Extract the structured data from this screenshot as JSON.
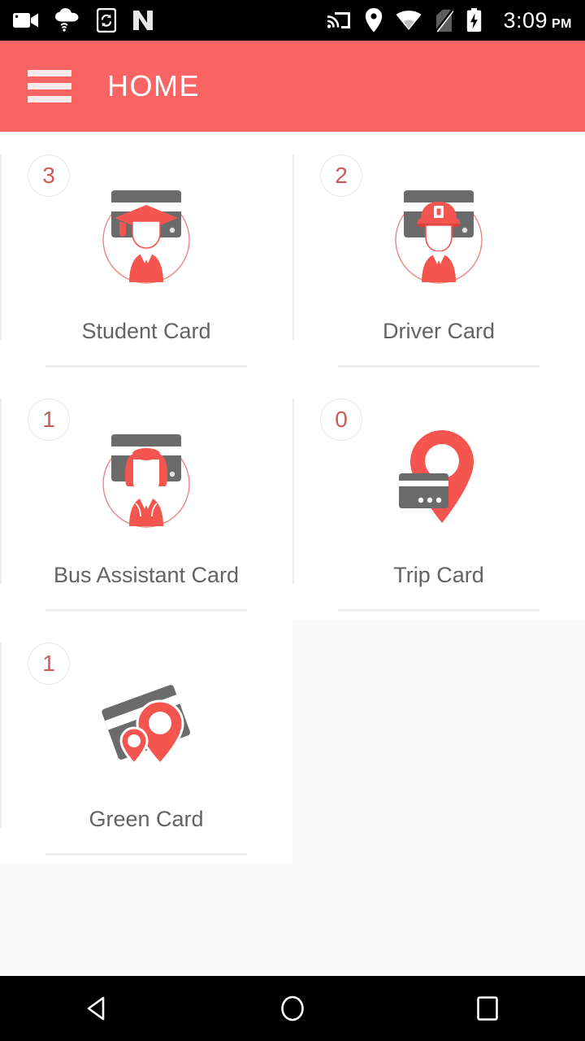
{
  "status_bar": {
    "icons_left": [
      "video-camera-icon",
      "cloud-wifi-icon",
      "phone-sync-icon",
      "nougat-n-icon"
    ],
    "icons_right": [
      "cast-screen-icon",
      "location-pin-icon",
      "wifi-icon",
      "sim-off-icon",
      "battery-charging-icon"
    ],
    "time": "3:09",
    "meridiem": "PM"
  },
  "appbar": {
    "menu_icon": "hamburger-menu-icon",
    "title": "HOME",
    "background_color": "#FB6464"
  },
  "theme": {
    "accent": "#FB6464",
    "icon_red": "#F4564F",
    "icon_gray": "#6B6B6B",
    "label_gray": "#636363",
    "badge_text": "#CC5A5A",
    "page_background": "#FAFAFA",
    "card_background": "#FFFFFF",
    "divider": "#EDEDED"
  },
  "cards": [
    {
      "id": "student-card",
      "label": "Student Card",
      "count": "3",
      "icon": "graduate-person-card-icon"
    },
    {
      "id": "driver-card",
      "label": "Driver Card",
      "count": "2",
      "icon": "driver-person-card-icon"
    },
    {
      "id": "bus-assistant-card",
      "label": "Bus Assistant Card",
      "count": "1",
      "icon": "assistant-person-card-icon"
    },
    {
      "id": "trip-card",
      "label": "Trip Card",
      "count": "0",
      "icon": "pin-credit-card-icon"
    },
    {
      "id": "green-card",
      "label": "Green Card",
      "count": "1",
      "icon": "tilted-card-two-pins-icon"
    }
  ],
  "navbar": {
    "back": "back-triangle-icon",
    "home": "home-circle-icon",
    "recents": "recents-square-icon"
  }
}
